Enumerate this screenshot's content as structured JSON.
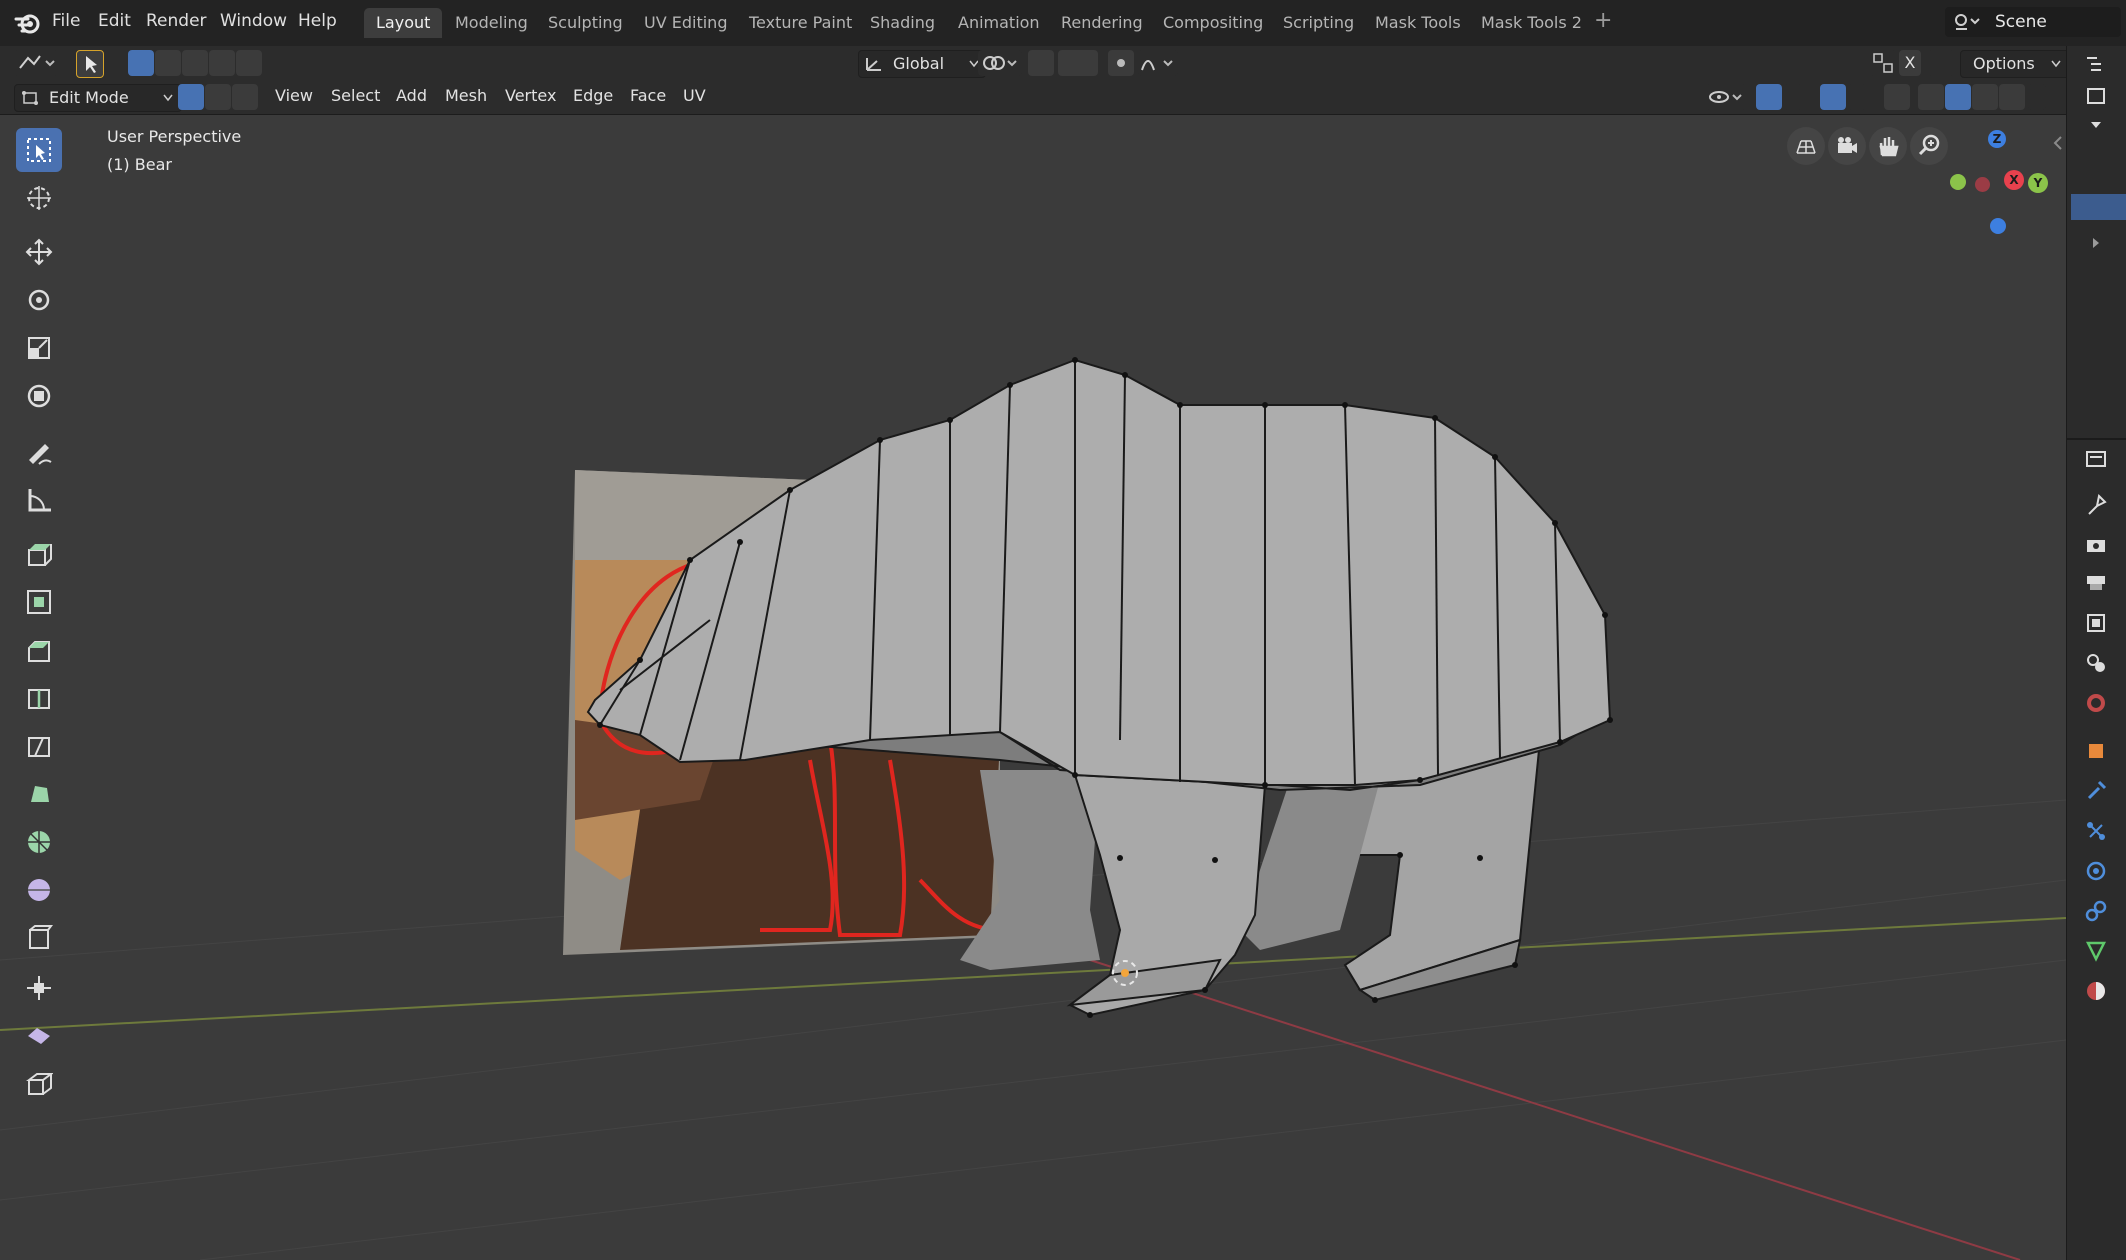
{
  "topbar": {
    "menus": [
      "File",
      "Edit",
      "Render",
      "Window",
      "Help"
    ],
    "workspaces": [
      "Layout",
      "Modeling",
      "Sculpting",
      "UV Editing",
      "Texture Paint",
      "Shading",
      "Animation",
      "Rendering",
      "Compositing",
      "Scripting",
      "Mask Tools",
      "Mask Tools 2"
    ],
    "active_workspace": "Layout",
    "add_tab": "+",
    "scene": "Scene"
  },
  "tool_header": {
    "transform_orientation": "Global",
    "options_label": "Options",
    "x_label": "X"
  },
  "editor_header": {
    "mode": "Edit Mode",
    "menus": [
      "View",
      "Select",
      "Add",
      "Mesh",
      "Vertex",
      "Edge",
      "Face",
      "UV"
    ]
  },
  "viewport": {
    "perspective": "User Perspective",
    "object": "(1) Bear"
  },
  "gizmo": {
    "z": "Z",
    "x": "X",
    "y": "Y"
  },
  "colors": {
    "accent": "#4772b3",
    "x_axis": "#e8414d",
    "y_axis": "#8bc34a",
    "z_axis": "#3d7fe0",
    "mesh_face": "#a9a9a9",
    "trace_line": "#e0261f"
  },
  "toolbar_tools": [
    "select-box",
    "cursor",
    "move",
    "rotate",
    "scale",
    "transform",
    "annotate",
    "measure",
    "extrude-region",
    "inset-faces",
    "bevel",
    "loop-cut",
    "knife",
    "poly-build",
    "spin",
    "smooth",
    "edge-slide",
    "shrink-fatten",
    "shear",
    "rip-region"
  ]
}
